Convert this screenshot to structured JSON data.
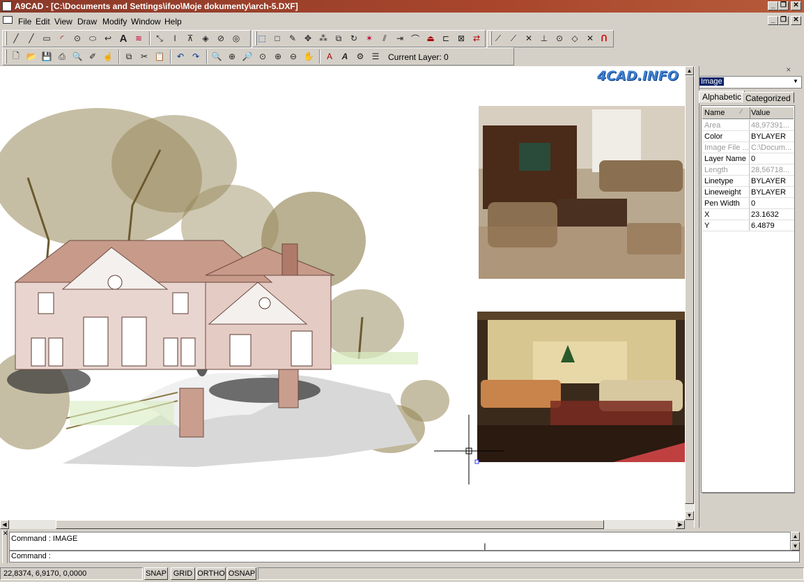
{
  "window": {
    "title": "A9CAD - [C:\\Documents and Settings\\ifoo\\Moje dokumenty\\arch-5.DXF]",
    "minimize": "_",
    "restore": "❐",
    "close": "✕"
  },
  "menu": [
    "File",
    "Edit",
    "View",
    "Draw",
    "Modify",
    "Window",
    "Help"
  ],
  "toolbar": {
    "current_layer_label": "Current Layer: 0"
  },
  "canvas": {
    "watermark": "4CAD.INFO"
  },
  "properties": {
    "object_type": "Image",
    "tabs": [
      "Alphabetic",
      "Categorized"
    ],
    "col_name": "Name",
    "col_value": "Value",
    "rows": [
      {
        "name": "Area",
        "value": "48,97391...",
        "disabled": true
      },
      {
        "name": "Color",
        "value": "BYLAYER",
        "disabled": false
      },
      {
        "name": "Image File ...",
        "value": "C:\\Docum...",
        "disabled": true
      },
      {
        "name": "Layer Name",
        "value": "0",
        "disabled": false
      },
      {
        "name": "Length",
        "value": "28,56718...",
        "disabled": true
      },
      {
        "name": "Linetype",
        "value": "BYLAYER",
        "disabled": false
      },
      {
        "name": "Lineweight",
        "value": "BYLAYER",
        "disabled": false
      },
      {
        "name": "Pen Width",
        "value": "0",
        "disabled": false
      },
      {
        "name": "X",
        "value": "23.1632",
        "disabled": false
      },
      {
        "name": "Y",
        "value": "6.4879",
        "disabled": false
      }
    ]
  },
  "command": {
    "history": "Command : IMAGE",
    "prompt": "Command :"
  },
  "status": {
    "coords": "22,8374, 6,9170, 0,0000",
    "snap": "SNAP",
    "grid": "GRID",
    "ortho": "ORTHO",
    "osnap": "OSNAP"
  },
  "colors": {
    "title_bar": "#a8452c",
    "window_bg": "#d4d0c8",
    "tree_olive": "#8a7a45",
    "brick": "#b07a6a"
  }
}
